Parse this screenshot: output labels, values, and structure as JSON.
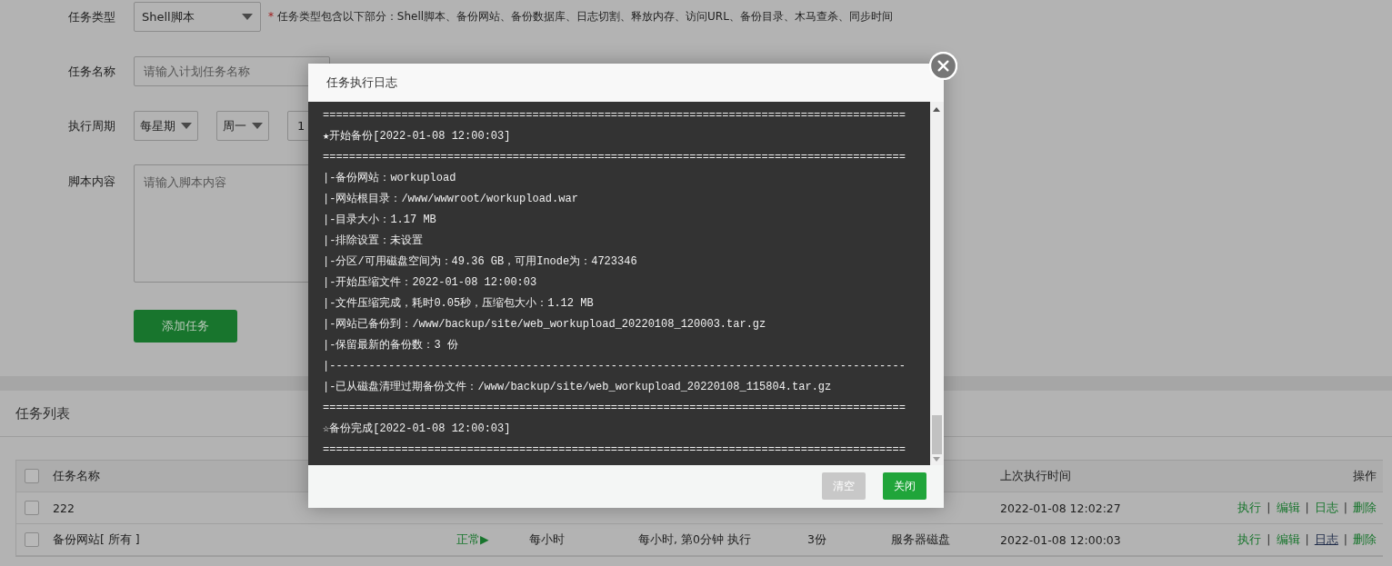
{
  "form": {
    "fields": [
      {
        "kind": "select",
        "label": "任务类型",
        "value": "Shell脚本",
        "hint": "任务类型包含以下部分：Shell脚本、备份网站、备份数据库、日志切割、释放内存、访问URL、备份目录、木马查杀、同步时间",
        "required_mark": "*"
      },
      {
        "kind": "text",
        "label": "任务名称",
        "placeholder": "请输入计划任务名称"
      },
      {
        "kind": "period",
        "label": "执行周期",
        "selects": [
          "每星期",
          "周一"
        ],
        "value": "1"
      },
      {
        "kind": "textarea",
        "label": "脚本内容",
        "placeholder": "请输入脚本内容"
      }
    ],
    "submit": "添加任务"
  },
  "task_list": {
    "title": "任务列表",
    "header_checked": false,
    "separator": "|",
    "columns": {
      "name": "任务名称",
      "last_run": "上次执行时间",
      "actions": "操作"
    },
    "rows": [
      {
        "checked": false,
        "name": "222",
        "last_run": "2022-01-08 12:02:27",
        "actions": [
          {
            "label": "执行",
            "hovered": false
          },
          {
            "label": "编辑",
            "hovered": false
          },
          {
            "label": "日志",
            "hovered": false
          },
          {
            "label": "删除",
            "hovered": false
          }
        ]
      },
      {
        "checked": false,
        "name": "备份网站[ 所有 ]",
        "status": "正常▶",
        "period": "每小时",
        "detail": "每小时, 第0分钟 执行",
        "count": "3份",
        "backup_to": "服务器磁盘",
        "last_run": "2022-01-08 12:00:03",
        "actions": [
          {
            "label": "执行",
            "hovered": false
          },
          {
            "label": "编辑",
            "hovered": false
          },
          {
            "label": "日志",
            "hovered": true
          },
          {
            "label": "删除",
            "hovered": false
          }
        ]
      }
    ]
  },
  "dialog": {
    "title": "任务执行日志",
    "log_lines": [
      "=========================================================================================",
      "★开始备份[2022-01-08 12:00:03]",
      "=========================================================================================",
      "|-备份网站：workupload",
      "|-网站根目录：/www/wwwroot/workupload.war",
      "|-目录大小：1.17 MB",
      "|-排除设置：未设置",
      "|-分区/可用磁盘空间为：49.36 GB，可用Inode为：4723346",
      "|-开始压缩文件：2022-01-08 12:00:03",
      "|-文件压缩完成，耗时0.05秒，压缩包大小：1.12 MB",
      "|-网站已备份到：/www/backup/site/web_workupload_20220108_120003.tar.gz",
      "|-保留最新的备份数：3 份",
      "|----------------------------------------------------------------------------------------",
      "|-已从磁盘清理过期备份文件：/www/backup/site/web_workupload_20220108_115804.tar.gz",
      "=========================================================================================",
      "☆备份完成[2022-01-08 12:00:03]",
      "========================================================================================="
    ],
    "buttons": [
      {
        "label": "清空",
        "disabled": true
      },
      {
        "label": "关闭",
        "disabled": false
      }
    ]
  }
}
